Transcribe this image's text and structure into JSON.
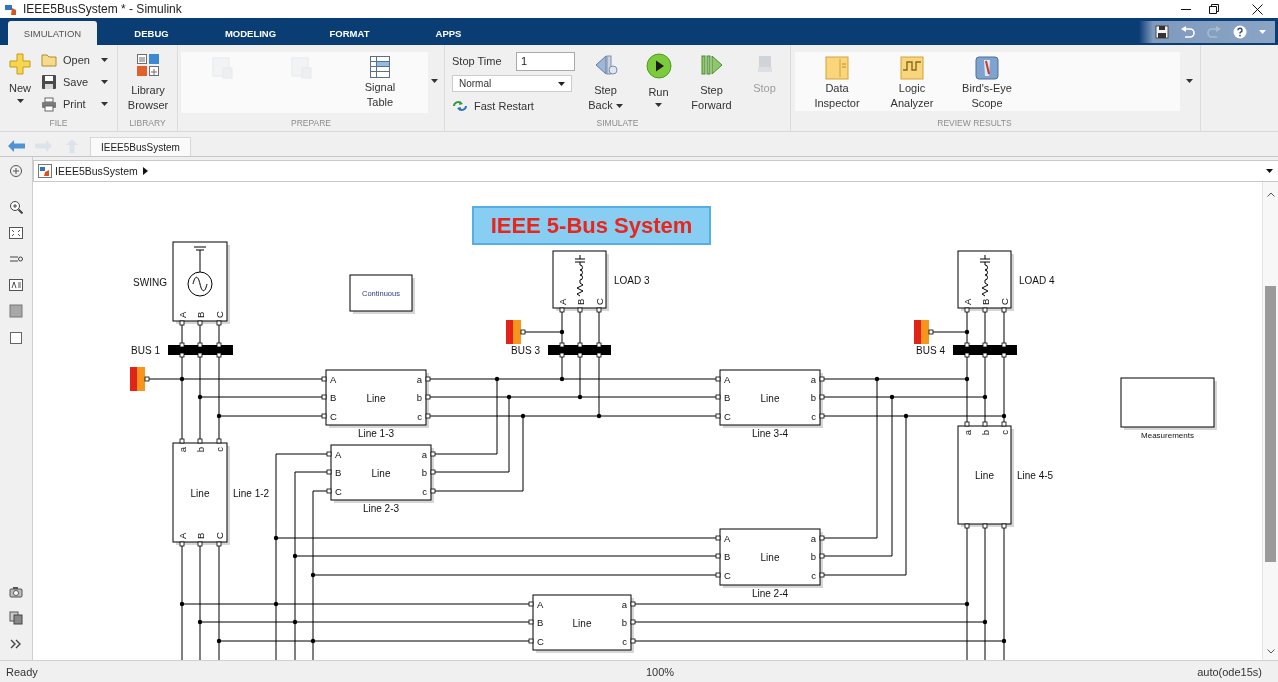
{
  "window": {
    "title": "IEEE5BusSystem * - Simulink"
  },
  "tabs": [
    {
      "label": "SIMULATION",
      "selected": true
    },
    {
      "label": "DEBUG",
      "selected": false
    },
    {
      "label": "MODELING",
      "selected": false
    },
    {
      "label": "FORMAT",
      "selected": false
    },
    {
      "label": "APPS",
      "selected": false
    }
  ],
  "ribbon": {
    "sections": [
      {
        "kind": "file",
        "label": "FILE",
        "new_button": {
          "label": "New",
          "menu": true
        },
        "buttons": [
          {
            "label": "Open",
            "menu": true
          },
          {
            "label": "Save",
            "menu": true
          },
          {
            "label": "Print",
            "menu": true
          }
        ]
      },
      {
        "kind": "library",
        "label": "LIBRARY",
        "buttons": [
          {
            "label": "Library Browser",
            "menu": false
          }
        ]
      },
      {
        "kind": "prepare",
        "label": "PREPARE",
        "buttons": [
          {
            "disabled": true,
            "menu": false
          },
          {
            "disabled": true,
            "menu": false
          },
          {
            "label": "Signal Table",
            "disabled": false,
            "menu": false
          }
        ]
      },
      {
        "kind": "simulate",
        "label": "SIMULATE",
        "stop_time": {
          "label": "Stop Time",
          "value": "1"
        },
        "mode": {
          "value": "Normal"
        },
        "fast_restart": {
          "label": "Fast Restart"
        },
        "buttons": [
          {
            "label": "Step Back",
            "disabled": false,
            "menu": true
          },
          {
            "label": "Run",
            "disabled": false,
            "menu": true
          },
          {
            "label": "Step Forward",
            "disabled": false,
            "menu": false
          },
          {
            "label": "Stop",
            "disabled": true,
            "menu": false
          }
        ]
      },
      {
        "kind": "review",
        "label": "REVIEW RESULTS",
        "buttons": [
          {
            "label": "Data Inspector",
            "menu": false
          },
          {
            "label": "Logic Analyzer",
            "menu": false
          },
          {
            "label": "Bird's-Eye Scope",
            "menu": false
          }
        ]
      }
    ]
  },
  "explorer_bar": {
    "tab": "IEEE5BusSystem"
  },
  "breadcrumb": {
    "path": "IEEE5BusSystem"
  },
  "diagram": {
    "title": "IEEE 5-Bus System",
    "blocks": [
      {
        "kind": "source",
        "label": "SWING",
        "ports": [
          "A",
          "B",
          "C"
        ]
      },
      {
        "kind": "bus",
        "label": "BUS 1"
      },
      {
        "kind": "bus_marker"
      },
      {
        "kind": "powergui",
        "text": "Continuous"
      },
      {
        "kind": "load",
        "label": "LOAD 3",
        "ports": [
          "A",
          "B",
          "C"
        ]
      },
      {
        "kind": "bus_marker"
      },
      {
        "kind": "bus",
        "label": "BUS 3"
      },
      {
        "kind": "load",
        "label": "LOAD 4",
        "ports": [
          "A",
          "B",
          "C"
        ]
      },
      {
        "kind": "bus_marker"
      },
      {
        "kind": "bus",
        "label": "BUS 4"
      },
      {
        "kind": "line",
        "text": "Line",
        "label": "Line 1-3",
        "ports_in": [
          "A",
          "B",
          "C"
        ],
        "ports_out": [
          "a",
          "b",
          "c"
        ]
      },
      {
        "kind": "line",
        "text": "Line",
        "label": "Line 3-4",
        "ports_in": [
          "A",
          "B",
          "C"
        ],
        "ports_out": [
          "a",
          "b",
          "c"
        ]
      },
      {
        "kind": "measurements",
        "label": "Measurements"
      },
      {
        "kind": "vertical_line",
        "text": "Line",
        "label": "Line 1-2",
        "ports_top": [
          "a",
          "b",
          "c"
        ],
        "ports_bottom": [
          "A",
          "B",
          "C"
        ]
      },
      {
        "kind": "line",
        "text": "Line",
        "label": "Line 2-3",
        "ports_in": [
          "A",
          "B",
          "C"
        ],
        "ports_out": [
          "a",
          "b",
          "c"
        ]
      },
      {
        "kind": "vertical_line",
        "text": "Line",
        "label": "Line 4-5",
        "ports_top": [
          "a",
          "b",
          "c"
        ]
      },
      {
        "kind": "line",
        "text": "Line",
        "label": "Line 2-4",
        "ports_in": [
          "A",
          "B",
          "C"
        ],
        "ports_out": [
          "a",
          "b",
          "c"
        ]
      },
      {
        "kind": "line",
        "text": "Line",
        "ports_in": [
          "A",
          "B",
          "C"
        ],
        "ports_out": [
          "a",
          "b",
          "c"
        ]
      }
    ]
  },
  "status_bar": {
    "status": "Ready",
    "zoom": "100%",
    "solver": "auto(ode15s)"
  }
}
